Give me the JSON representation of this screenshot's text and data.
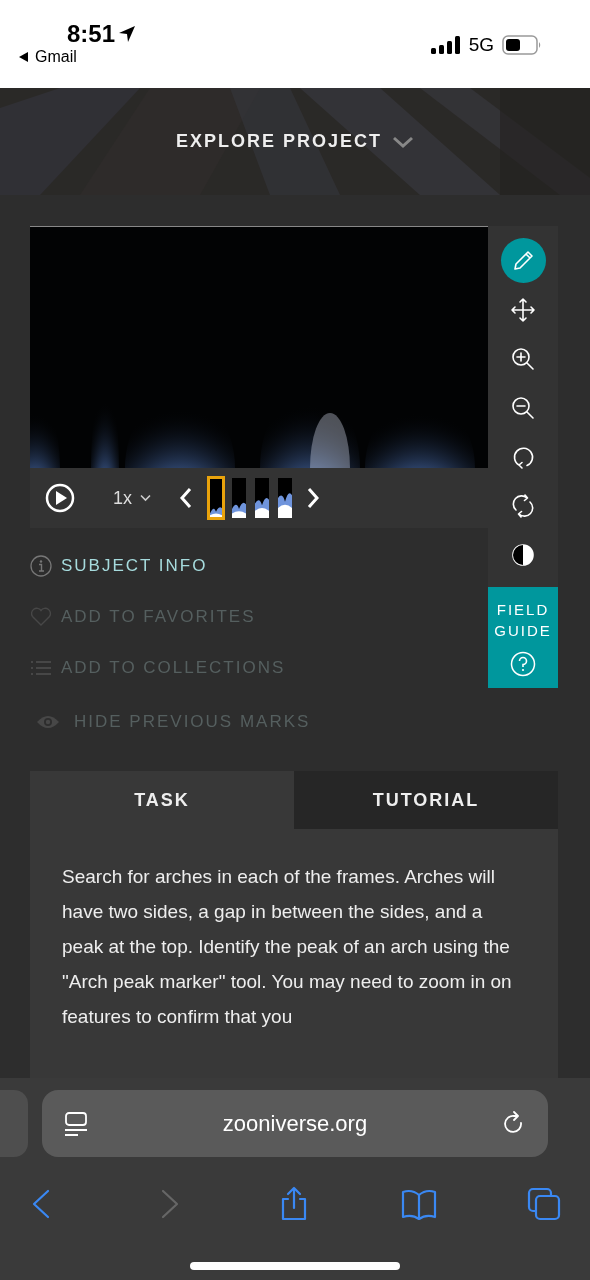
{
  "status_bar": {
    "time": "8:51",
    "back_app": "Gmail",
    "network": "5G"
  },
  "header": {
    "title": "EXPLORE PROJECT"
  },
  "viewer": {
    "speed": "1x",
    "frames": [
      {
        "selected": true
      },
      {
        "selected": false
      },
      {
        "selected": false
      },
      {
        "selected": false
      }
    ],
    "tools": [
      {
        "kind": "draw",
        "selected": true
      },
      {
        "kind": "move",
        "selected": false
      },
      {
        "kind": "zoom-in",
        "selected": false
      },
      {
        "kind": "zoom-out",
        "selected": false
      },
      {
        "kind": "rotate",
        "selected": false
      },
      {
        "kind": "reset",
        "selected": false
      },
      {
        "kind": "invert",
        "selected": false
      }
    ],
    "field_guide": "FIELD GUIDE"
  },
  "links": [
    {
      "kind": "info",
      "label": "SUBJECT INFO",
      "disabled": false
    },
    {
      "kind": "favorite",
      "label": "ADD TO FAVORITES",
      "disabled": true
    },
    {
      "kind": "collection",
      "label": "ADD TO COLLECTIONS",
      "disabled": true
    },
    {
      "kind": "eye",
      "label": "HIDE PREVIOUS MARKS",
      "disabled": true
    }
  ],
  "tabs": [
    {
      "label": "TASK",
      "selected": true
    },
    {
      "label": "TUTORIAL",
      "selected": false
    }
  ],
  "task": {
    "text": "Search for arches in each of the frames. Arches will have two sides, a gap in between the sides, and a peak at the top. Identify the peak of an arch using the \"Arch peak marker\" tool. You may need to zoom in on features to confirm that you"
  },
  "browser": {
    "url": "zooniverse.org",
    "toolbar": [
      {
        "kind": "back",
        "disabled": false
      },
      {
        "kind": "forward",
        "disabled": true
      },
      {
        "kind": "share",
        "disabled": false
      },
      {
        "kind": "bookmarks",
        "disabled": false
      },
      {
        "kind": "tabs",
        "disabled": false
      }
    ]
  }
}
